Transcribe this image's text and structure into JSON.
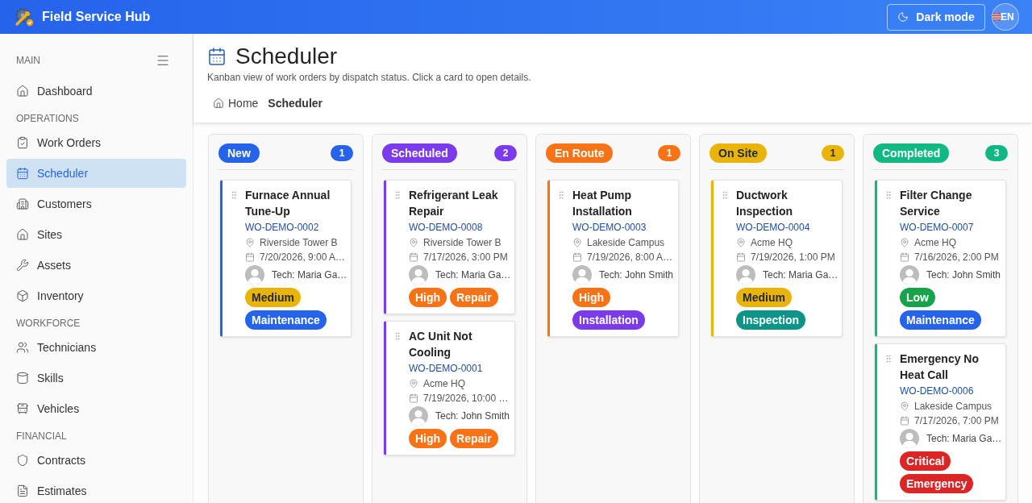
{
  "app_bar": {
    "title": "Field Service Hub",
    "theme_button": "Dark mode",
    "language_button": "EN"
  },
  "sidebar": {
    "sections": [
      {
        "label": "MAIN",
        "items": [
          {
            "label": "Dashboard",
            "selected": false
          }
        ]
      },
      {
        "label": "OPERATIONS",
        "items": [
          {
            "label": "Work Orders",
            "selected": false
          },
          {
            "label": "Scheduler",
            "selected": true
          },
          {
            "label": "Customers",
            "selected": false
          },
          {
            "label": "Sites",
            "selected": false
          },
          {
            "label": "Assets",
            "selected": false
          },
          {
            "label": "Inventory",
            "selected": false
          }
        ]
      },
      {
        "label": "WORKFORCE",
        "items": [
          {
            "label": "Technicians",
            "selected": false
          },
          {
            "label": "Skills",
            "selected": false
          },
          {
            "label": "Vehicles",
            "selected": false
          }
        ]
      },
      {
        "label": "FINANCIAL",
        "items": [
          {
            "label": "Contracts",
            "selected": false
          },
          {
            "label": "Estimates",
            "selected": false
          }
        ]
      }
    ]
  },
  "page": {
    "title": "Scheduler",
    "subtitle": "Kanban view of work orders by dispatch status. Click a card to open details.",
    "breadcrumb": [
      {
        "label": "Home",
        "current": false
      },
      {
        "label": "Scheduler",
        "current": true
      }
    ]
  },
  "board": {
    "columns": [
      {
        "status": "New",
        "count": "1",
        "color": "#2563eb",
        "cards": [
          {
            "title": "Furnace Annual Tune-Up",
            "number": "WO-DEMO-0002",
            "site": "Riverside Tower B",
            "scheduled": "7/20/2026, 9:00 A…",
            "technician": "Tech: Maria Ga…",
            "tags": [
              {
                "label": "Medium",
                "color": "#eab308"
              },
              {
                "label": "Maintenance",
                "color": "#2563eb"
              }
            ]
          }
        ]
      },
      {
        "status": "Scheduled",
        "count": "2",
        "color": "#7c3aed",
        "cards": [
          {
            "title": "Refrigerant Leak Repair",
            "number": "WO-DEMO-0008",
            "site": "Riverside Tower B",
            "scheduled": "7/17/2026, 3:00 PM",
            "technician": "Tech: Maria Ga…",
            "tags": [
              {
                "label": "High",
                "color": "#f97316"
              },
              {
                "label": "Repair",
                "color": "#f97316"
              }
            ]
          },
          {
            "title": "AC Unit Not Cooling",
            "number": "WO-DEMO-0001",
            "site": "Acme HQ",
            "scheduled": "7/19/2026, 10:00 …",
            "technician": "Tech: John Smith",
            "tags": [
              {
                "label": "High",
                "color": "#f97316"
              },
              {
                "label": "Repair",
                "color": "#f97316"
              }
            ]
          }
        ]
      },
      {
        "status": "En Route",
        "count": "1",
        "color": "#f97316",
        "cards": [
          {
            "title": "Heat Pump Installation",
            "number": "WO-DEMO-0003",
            "site": "Lakeside Campus",
            "scheduled": "7/19/2026, 8:00 A…",
            "technician": "Tech: John Smith",
            "tags": [
              {
                "label": "High",
                "color": "#f97316"
              },
              {
                "label": "Installation",
                "color": "#7c3aed"
              }
            ]
          }
        ]
      },
      {
        "status": "On Site",
        "count": "1",
        "color": "#eab308",
        "cards": [
          {
            "title": "Ductwork Inspection",
            "number": "WO-DEMO-0004",
            "site": "Acme HQ",
            "scheduled": "7/19/2026, 1:00 PM",
            "technician": "Tech: Maria Ga…",
            "tags": [
              {
                "label": "Medium",
                "color": "#eab308"
              },
              {
                "label": "Inspection",
                "color": "#0d9488"
              }
            ]
          }
        ]
      },
      {
        "status": "Completed",
        "count": "3",
        "color": "#10b981",
        "cards": [
          {
            "title": "Filter Change Service",
            "number": "WO-DEMO-0007",
            "site": "Acme HQ",
            "scheduled": "7/16/2026, 2:00 PM",
            "technician": "Tech: John Smith",
            "tags": [
              {
                "label": "Low",
                "color": "#16a34a"
              },
              {
                "label": "Maintenance",
                "color": "#2563eb"
              }
            ]
          },
          {
            "title": "Emergency No Heat Call",
            "number": "WO-DEMO-0006",
            "site": "Lakeside Campus",
            "scheduled": "7/17/2026, 7:00 PM",
            "technician": "Tech: Maria Ga…",
            "tags": [
              {
                "label": "Critical",
                "color": "#dc2626"
              },
              {
                "label": "Emergency",
                "color": "#dc2626"
              }
            ]
          }
        ]
      }
    ]
  }
}
